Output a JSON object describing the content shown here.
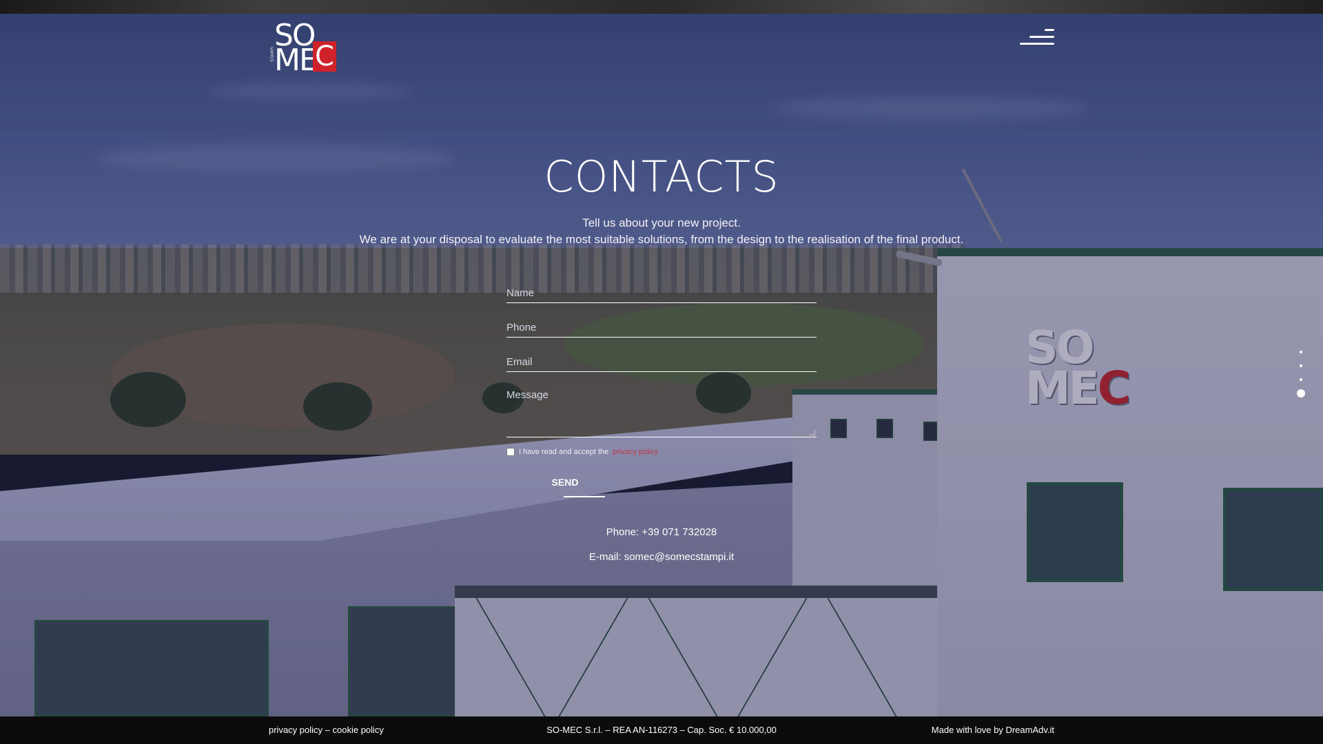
{
  "brand": {
    "logo_top": "SO",
    "logo_bottom_left": "ME",
    "logo_bottom_right": "C",
    "logo_side": "STAMPI",
    "accent_red": "#d0222a"
  },
  "header": {
    "menu_icon": "hamburger-menu-icon"
  },
  "main": {
    "title": "CONTACTS",
    "intro_line1": "Tell us about your new project.",
    "intro_line2": "We are at your disposal to evaluate the most suitable solutions, from the design to the realisation of the final product."
  },
  "form": {
    "name_placeholder": "Name",
    "phone_placeholder": "Phone",
    "email_placeholder": "Email",
    "message_placeholder": "Message",
    "consent_text": "I have read and accept the",
    "consent_link": "privacy policy",
    "send_label": "SEND"
  },
  "contact": {
    "phone": "Phone: +39 071 732028",
    "email": "E-mail: somec@somecstampi.it"
  },
  "slider": {
    "total_slides": 4,
    "active_slide": 4
  },
  "footer": {
    "privacy_link": "privacy policy",
    "separator": " – ",
    "cookie_link": "cookie policy",
    "company_info": "SO-MEC S.r.l. – REA AN-116273 – Cap. Soc. € 10.000,00",
    "credits": "Made with love by DreamAdv.it"
  }
}
